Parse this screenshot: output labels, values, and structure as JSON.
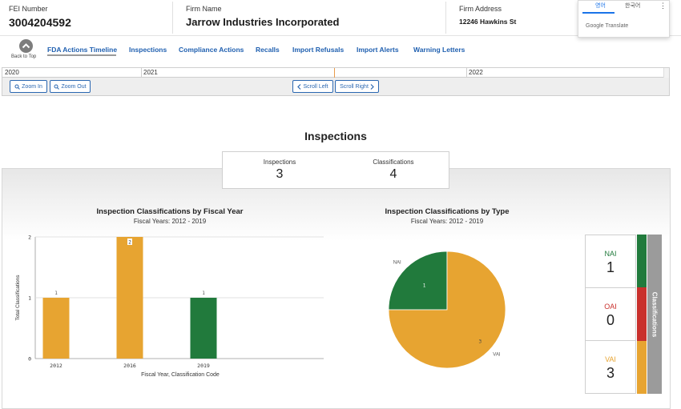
{
  "header": {
    "fei_label": "FEI Number",
    "fei_value": "3004204592",
    "firm_label": "Firm Name",
    "firm_value": "Jarrow Industries Incorporated",
    "address_label": "Firm Address",
    "address_value": "12246 Hawkins St"
  },
  "translate": {
    "tab_active": "영어",
    "tab_other": "한국어",
    "menu": "⋮",
    "brand": "Google Translate"
  },
  "nav": {
    "back_to_top": "Back to Top",
    "items": [
      "FDA Actions Timeline",
      "Inspections",
      "Compliance Actions",
      "Recalls",
      "Import Refusals",
      "Import Alerts",
      "Warning Letters"
    ]
  },
  "timeline": {
    "years": [
      "2020",
      "2021",
      "2022"
    ],
    "zoom_in": "Zoom In",
    "zoom_out": "Zoom Out",
    "scroll_left": "Scroll Left",
    "scroll_right": "Scroll Right"
  },
  "section": {
    "title": "Inspections",
    "stats": [
      {
        "label": "Inspections",
        "value": "3"
      },
      {
        "label": "Classifications",
        "value": "4"
      }
    ]
  },
  "classification_cards": [
    {
      "label": "NAI",
      "value": "1",
      "color": "#217a3c"
    },
    {
      "label": "OAI",
      "value": "0",
      "color": "#c9302c"
    },
    {
      "label": "VAI",
      "value": "3",
      "color": "#e7a431"
    }
  ],
  "classifications_label": "Classifications",
  "colors": {
    "link": "#2060b0",
    "nai": "#217a3c",
    "oai": "#c9302c",
    "vai": "#e7a431"
  },
  "chart_data": [
    {
      "type": "bar",
      "title": "Inspection Classifications by Fiscal Year",
      "subtitle": "Fiscal Years: 2012 - 2019",
      "xlabel": "Fiscal Year, Classification Code",
      "ylabel": "Total Classifications",
      "categories": [
        "2012",
        "2016",
        "2019"
      ],
      "series": [
        {
          "code": "VAI",
          "values": [
            1,
            2,
            0
          ]
        },
        {
          "code": "NAI",
          "values": [
            0,
            0,
            1
          ]
        }
      ],
      "yticks": [
        0,
        1,
        2
      ],
      "ylim": [
        0,
        2
      ],
      "grid": true
    },
    {
      "type": "pie",
      "title": "Inspection Classifications by Type",
      "subtitle": "Fiscal Years: 2012 - 2019",
      "slices": [
        {
          "label": "NAI",
          "value": 1
        },
        {
          "label": "VAI",
          "value": 3
        }
      ]
    }
  ]
}
